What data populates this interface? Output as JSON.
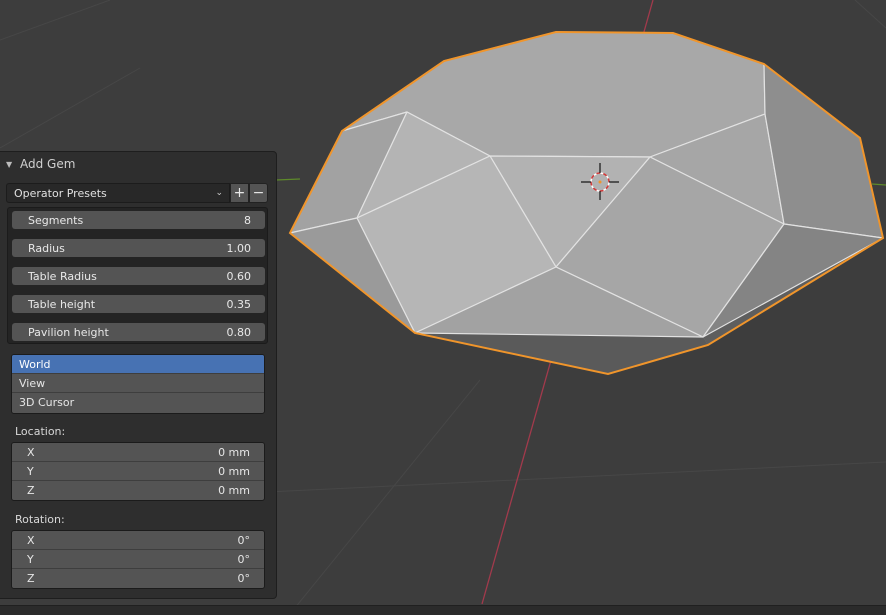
{
  "panel": {
    "title": "Add Gem",
    "collapse_icon": "triangle-down-icon",
    "presets": {
      "label": "Operator Presets",
      "add_label": "+",
      "remove_label": "−"
    },
    "properties": [
      {
        "name": "Segments",
        "value": "8"
      },
      {
        "name": "Radius",
        "value": "1.00"
      },
      {
        "name": "Table Radius",
        "value": "0.60"
      },
      {
        "name": "Table height",
        "value": "0.35"
      },
      {
        "name": "Pavilion height",
        "value": "0.80"
      }
    ],
    "align": {
      "options": [
        "World",
        "View",
        "3D Cursor"
      ],
      "selected": "World"
    },
    "location": {
      "label": "Location:",
      "rows": [
        {
          "axis": "X",
          "value": "0 mm"
        },
        {
          "axis": "Y",
          "value": "0 mm"
        },
        {
          "axis": "Z",
          "value": "0 mm"
        }
      ]
    },
    "rotation": {
      "label": "Rotation:",
      "rows": [
        {
          "axis": "X",
          "value": "0°"
        },
        {
          "axis": "Y",
          "value": "0°"
        },
        {
          "axis": "Z",
          "value": "0°"
        }
      ]
    }
  },
  "viewport": {
    "background_color": "#3d3d3d",
    "grid_color": "#474747",
    "x_axis_color": "#a23a4c",
    "y_axis_color": "#5e8a2a",
    "selection_outline_color": "#f0952b",
    "cursor_icon": "3d-cursor-icon"
  }
}
